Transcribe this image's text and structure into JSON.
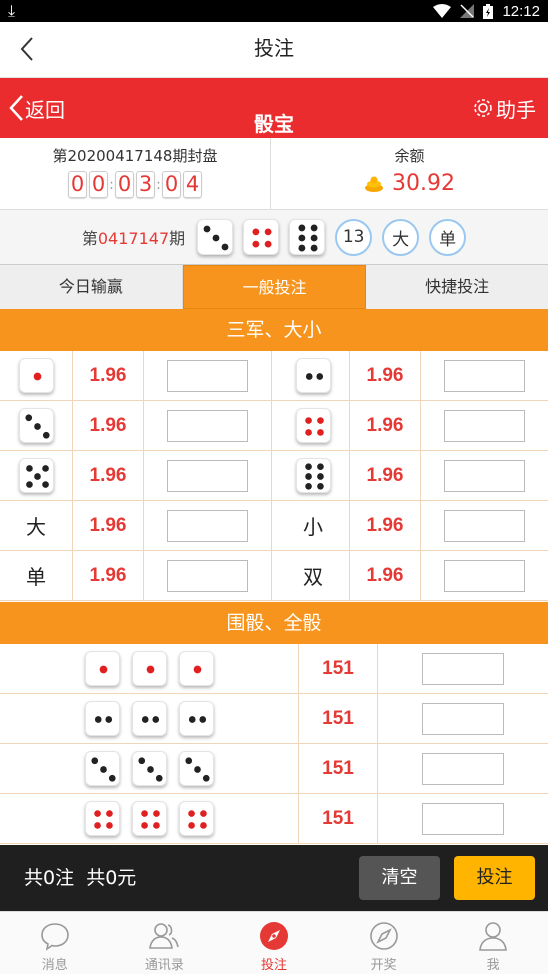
{
  "status_bar": {
    "time": "12:12"
  },
  "nav": {
    "title": "投注"
  },
  "game_header": {
    "back_label": "返回",
    "title": "骰宝",
    "helper_label": "助手"
  },
  "draw_info": {
    "closing_label": "第20200417148期封盘",
    "countdown": [
      "0",
      "0",
      "0",
      "3",
      "0",
      "4"
    ],
    "balance_label": "余额",
    "balance_value": "30.92"
  },
  "last_draw": {
    "prefix": "第",
    "issue": "0417147",
    "suffix": "期",
    "dice": [
      3,
      4,
      6
    ],
    "sum": "13",
    "size": "大",
    "parity": "单"
  },
  "tabs": [
    {
      "label": "今日输赢",
      "active": false
    },
    {
      "label": "一般投注",
      "active": true
    },
    {
      "label": "快捷投注",
      "active": false
    }
  ],
  "section1": {
    "title": "三军、大小",
    "rows": [
      {
        "left": {
          "die": 1,
          "odds": "1.96"
        },
        "right": {
          "die": 2,
          "odds": "1.96"
        }
      },
      {
        "left": {
          "die": 3,
          "odds": "1.96"
        },
        "right": {
          "die": 4,
          "odds": "1.96"
        }
      },
      {
        "left": {
          "die": 5,
          "odds": "1.96"
        },
        "right": {
          "die": 6,
          "odds": "1.96"
        }
      },
      {
        "left": {
          "label": "大",
          "odds": "1.96"
        },
        "right": {
          "label": "小",
          "odds": "1.96"
        }
      },
      {
        "left": {
          "label": "单",
          "odds": "1.96"
        },
        "right": {
          "label": "双",
          "odds": "1.96"
        }
      }
    ]
  },
  "section2": {
    "title": "围骰、全骰",
    "rows": [
      {
        "dice": [
          1,
          1,
          1
        ],
        "odds": "151"
      },
      {
        "dice": [
          2,
          2,
          2
        ],
        "odds": "151"
      },
      {
        "dice": [
          3,
          3,
          3
        ],
        "odds": "151"
      },
      {
        "dice": [
          4,
          4,
          4
        ],
        "odds": "151"
      }
    ]
  },
  "footer": {
    "bets_label": "共0注",
    "amount_label": "共0元",
    "clear_label": "清空",
    "submit_label": "投注"
  },
  "tabbar": [
    {
      "label": "消息",
      "icon": "chat-bubble-icon",
      "active": false
    },
    {
      "label": "通讯录",
      "icon": "contacts-icon",
      "active": false
    },
    {
      "label": "投注",
      "icon": "compass-icon",
      "active": true
    },
    {
      "label": "开奖",
      "icon": "compass-outline-icon",
      "active": false
    },
    {
      "label": "我",
      "icon": "person-icon",
      "active": false
    }
  ],
  "colors": {
    "red": "#ea2c2e",
    "orange": "#f7941d",
    "odds_red": "#e53935",
    "gold": "#ffb400"
  }
}
